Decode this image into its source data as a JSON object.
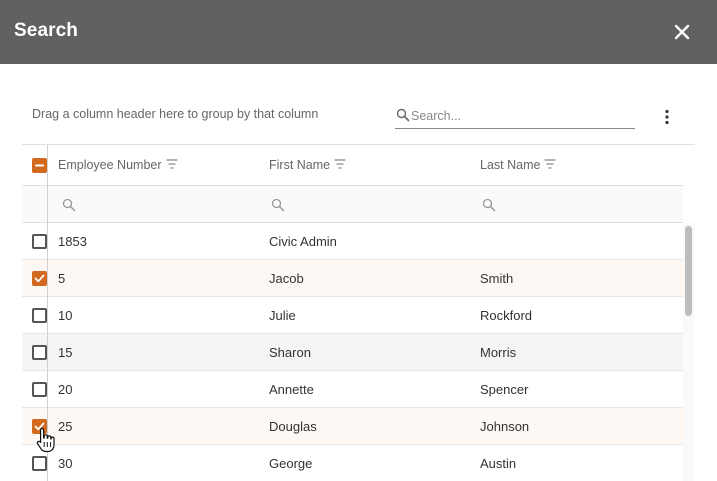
{
  "dialog": {
    "title": "Search"
  },
  "toolbar": {
    "group_hint": "Drag a column header here to group by that column",
    "search_placeholder": "Search..."
  },
  "grid": {
    "columns": [
      {
        "label": "Employee Number"
      },
      {
        "label": "First Name"
      },
      {
        "label": "Last Name"
      }
    ],
    "header_checkbox_state": "indeterminate",
    "rows": [
      {
        "employee_number": "1853",
        "first_name": "Civic Admin",
        "last_name": "",
        "checked": false
      },
      {
        "employee_number": "5",
        "first_name": "Jacob",
        "last_name": "Smith",
        "checked": true
      },
      {
        "employee_number": "10",
        "first_name": "Julie",
        "last_name": "Rockford",
        "checked": false
      },
      {
        "employee_number": "15",
        "first_name": "Sharon",
        "last_name": "Morris",
        "checked": false
      },
      {
        "employee_number": "20",
        "first_name": "Annette",
        "last_name": "Spencer",
        "checked": false
      },
      {
        "employee_number": "25",
        "first_name": "Douglas",
        "last_name": "Johnson",
        "checked": true
      },
      {
        "employee_number": "30",
        "first_name": "George",
        "last_name": "Austin",
        "checked": false
      }
    ]
  },
  "colors": {
    "titlebar": "#616161",
    "accent": "#d2691e",
    "selected_row": "#fdf8f4"
  },
  "icons": {
    "close": "close-icon",
    "search": "search-icon",
    "more": "more-vertical-icon",
    "filter": "filter-icon",
    "check": "check-icon",
    "cursor": "hand-pointer-cursor-icon"
  }
}
